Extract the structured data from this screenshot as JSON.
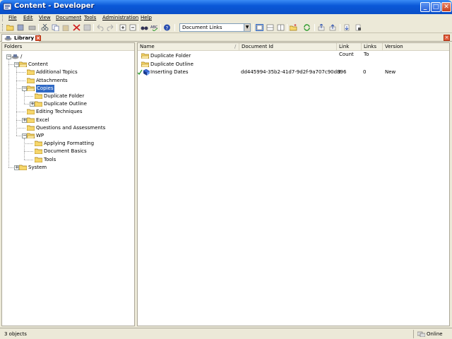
{
  "window": {
    "title": "Content - Developer"
  },
  "menu": [
    "File",
    "Edit",
    "View",
    "Document",
    "Tools",
    "Administration",
    "Help"
  ],
  "toolbar": {
    "doc_links_value": "Document Links"
  },
  "tab": {
    "label": "Library"
  },
  "folders_header": "Folders",
  "tree": [
    {
      "label": "/",
      "level": 0
    },
    {
      "label": "Content",
      "level": 1
    },
    {
      "label": "Additional Topics",
      "level": 2
    },
    {
      "label": "Attachments",
      "level": 2
    },
    {
      "label": "Copies",
      "level": 2,
      "selected": true
    },
    {
      "label": "Duplicate Folder",
      "level": 3
    },
    {
      "label": "Duplicate Outline",
      "level": 3
    },
    {
      "label": "Editing Techniques",
      "level": 2
    },
    {
      "label": "Excel",
      "level": 2
    },
    {
      "label": "Questions and Assessments",
      "level": 2
    },
    {
      "label": "WP",
      "level": 2
    },
    {
      "label": "Applying Formatting",
      "level": 3
    },
    {
      "label": "Document Basics",
      "level": 3
    },
    {
      "label": "Tools",
      "level": 3
    },
    {
      "label": "System",
      "level": 1
    }
  ],
  "list": {
    "columns": [
      "Name",
      "Document Id",
      "Link Count",
      "Links To",
      "Version"
    ],
    "rows": [
      {
        "type": "folder",
        "name": "Duplicate Folder",
        "doc_id": "",
        "link_count": "",
        "links_to": "",
        "version": ""
      },
      {
        "type": "folder",
        "name": "Duplicate Outline",
        "doc_id": "",
        "link_count": "",
        "links_to": "",
        "version": ""
      },
      {
        "type": "document",
        "name": "Inserting Dates",
        "doc_id": "dd445994-35b2-41d7-9d2f-9a707c90d896",
        "link_count": "3",
        "links_to": "0",
        "version": "New"
      }
    ]
  },
  "status": {
    "objects": "3 objects",
    "online": "Online"
  },
  "colors": {
    "title_blue": "#0a58d8",
    "selection": "#316ac5",
    "folder_yellow": "#f6d66b",
    "check_green": "#2a9a2a"
  }
}
